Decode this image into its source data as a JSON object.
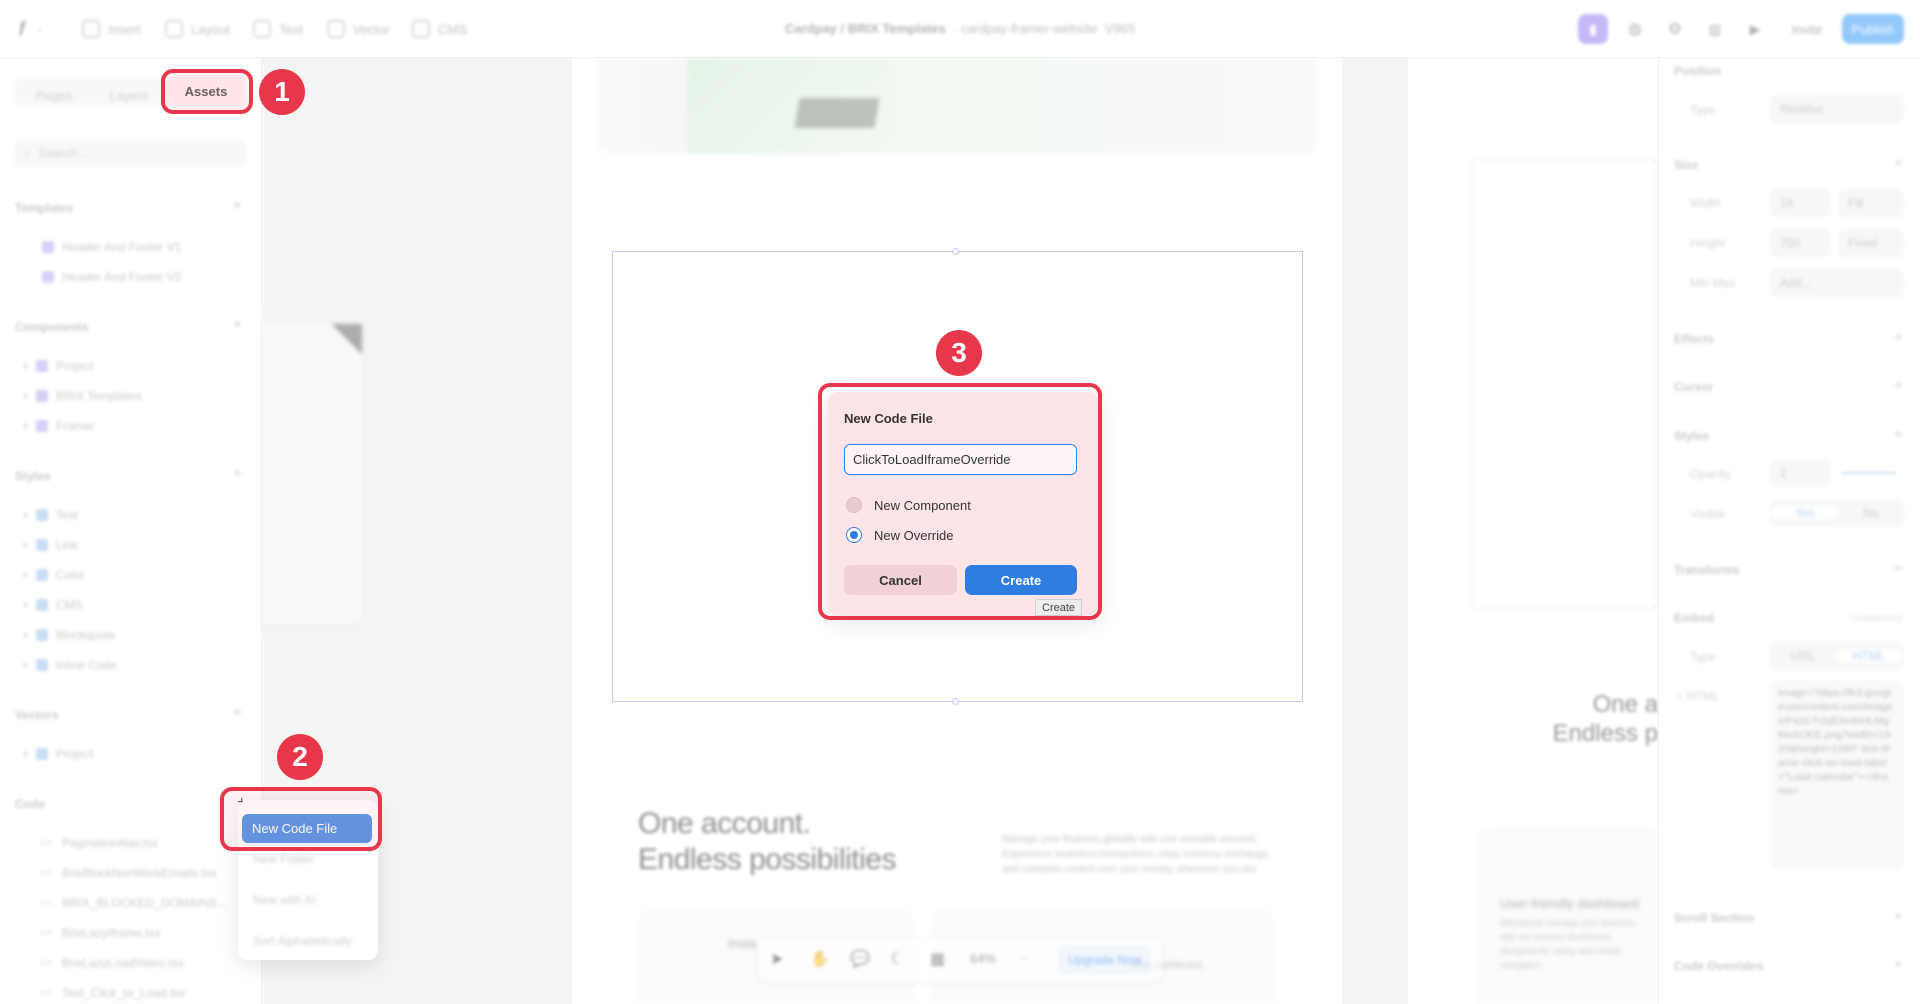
{
  "toolbar": {
    "items": [
      "Insert",
      "Layout",
      "Text",
      "Vector",
      "CMS"
    ],
    "project_title": "Cardpay / BRIX Templates",
    "project_subtitle": "cardpay-framer-website",
    "version": "V965",
    "invite_label": "Invite",
    "publish_label": "Publish"
  },
  "left_panel": {
    "tabs": [
      "Pages",
      "Layers",
      "Assets"
    ],
    "search_placeholder": "Search...",
    "sections": {
      "templates": {
        "title": "Templates",
        "items": [
          "Header And Footer V1",
          "Header And Footer V2"
        ]
      },
      "components": {
        "title": "Components",
        "items": [
          "Project",
          "BRIX Templates",
          "Framer"
        ]
      },
      "styles": {
        "title": "Styles",
        "items": [
          "Text",
          "Link",
          "Color",
          "CMS",
          "Blockquote",
          "Inline Code"
        ]
      },
      "vectors": {
        "title": "Vectors",
        "items": [
          "Project"
        ]
      },
      "code": {
        "title": "Code",
        "items": [
          "PaginationNav.tsx",
          "BrixBlockNonWorkEmails.tsx",
          "BRIX_BLOCKED_DOMAINS...",
          "BrixLazyIframe.tsx",
          "BrixLazyLoadVideo.tsx",
          "Test_Click_to_Load.tsx"
        ]
      }
    }
  },
  "context_menu": {
    "selected": "New Code File",
    "items": [
      "New Folder",
      "New with AI",
      "Sort Alphabetically"
    ]
  },
  "dialog": {
    "title": "New Code File",
    "input_value": "ClickToLoadIframeOverride",
    "options": [
      "New Component",
      "New Override"
    ],
    "selected_option": "New Override",
    "cancel_label": "Cancel",
    "create_label": "Create",
    "tooltip": "Create"
  },
  "canvas": {
    "headline_line1": "One account.",
    "headline_line2": "Endless possibilities",
    "description": "Manage your finances globally with one versatile account. Experience seamless transactions, easy currency exchange, and complete control over your money, whenever you are.",
    "card_left_label": "Insta",
    "card_right_text": "ative dashboard.",
    "right_headline_1": "One a",
    "right_headline_2": "Endless p",
    "right_card_title": "User-friendly dashboard",
    "right_card_text": "Effortlessly manage your finances with our intuitive dashboard, designed for clarity and simple navigation."
  },
  "bottom_toolbar": {
    "zoom": "64%",
    "upgrade_label": "Upgrade Now"
  },
  "right_panel": {
    "position": {
      "title": "Position",
      "type_label": "Type",
      "type_value": "Relative"
    },
    "size": {
      "title": "Size",
      "width_label": "Width",
      "width_value": "1fr",
      "width_mode": "Fill",
      "height_label": "Height",
      "height_value": "700",
      "height_mode": "Fixed",
      "minmax_label": "Min Max",
      "minmax_value": "Add..."
    },
    "effects_title": "Effects",
    "cursor_title": "Cursor",
    "styles": {
      "title": "Styles",
      "opacity_label": "Opacity",
      "opacity_value": "1",
      "visible_label": "Visible",
      "yes": "Yes",
      "no": "No"
    },
    "transforms_title": "Transforms",
    "embed": {
      "title": "Embed",
      "tag": "Component",
      "type_label": "Type",
      "url": "URL",
      "html": "HTML",
      "html_label": "HTML",
      "code": "image=\"https://lh3.googleusercontent.com/images/Pa317r2qlDirolsHLMgMoXOEE.png?width=1920&height=1080\" brix-iframe-click-on-load-label=\"Load calendar\"></iframe>"
    },
    "scroll_section_title": "Scroll Section",
    "code_overrides_title": "Code Overrides"
  },
  "callouts": [
    "1",
    "2",
    "3"
  ],
  "colors": {
    "accent": "#2f7de1",
    "callout": "#e8364a",
    "canvas_bg": "#f4f4f4"
  }
}
